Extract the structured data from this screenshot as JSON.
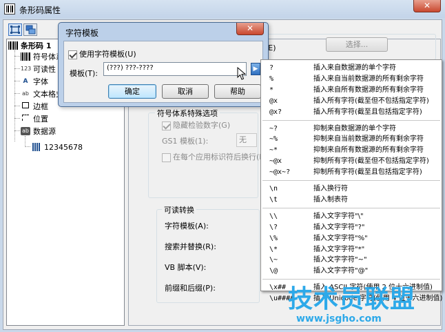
{
  "main_window": {
    "title": "条形码属性"
  },
  "tree": {
    "root": "条形码 1",
    "items": [
      "符号体系",
      "可读性",
      "字体",
      "文本格式",
      "边框",
      "位置",
      "数据源"
    ],
    "child": "12345678"
  },
  "pane": {
    "settings_label": "设置(E)",
    "select_button": "选择...",
    "group_symbology_title": "符号体系特殊选项",
    "hide_check_digit": "隐藏检验数字(G)",
    "gs1_template_label": "GS1 模板(1):",
    "gs1_template_value": "无",
    "wrap_each_ai": "在每个应用标识符后换行(L",
    "group_readable_title": "可读转换",
    "readable_rows": [
      "字符模板(A):",
      "搜索并替换(R):",
      "VB 脚本(V):",
      "前缀和后缀(P):"
    ]
  },
  "dialog": {
    "title": "字符模板",
    "close_glyph": "✕",
    "use_template_label": "使用字符模板(U)",
    "template_label": "模板(T):",
    "template_value": "(???) ???-????",
    "ok_button": "确定",
    "cancel_button": "取消",
    "help_button": "帮助"
  },
  "menu": {
    "groups": [
      [
        {
          "code": "?",
          "desc": "插入来自数据源的单个字符"
        },
        {
          "code": "%",
          "desc": "插入来自当前数据源的所有剩余字符"
        },
        {
          "code": "*",
          "desc": "插入来自所有数据源的所有剩余字符"
        },
        {
          "code": "@x",
          "desc": "插入所有字符(截至但不包括指定字符)"
        },
        {
          "code": "@x?",
          "desc": "插入所有字符(截至且包括指定字符)"
        }
      ],
      [
        {
          "code": "~?",
          "desc": "抑制来自数据源的单个字符"
        },
        {
          "code": "~%",
          "desc": "抑制来自当前数据源的所有剩余字符"
        },
        {
          "code": "~*",
          "desc": "抑制来自所有数据源的所有剩余字符"
        },
        {
          "code": "~@x",
          "desc": "抑制所有字符(截至但不包括指定字符)"
        },
        {
          "code": "~@x~?",
          "desc": "抑制所有字符(截至且包括指定字符)"
        }
      ],
      [
        {
          "code": "\\n",
          "desc": "插入换行符"
        },
        {
          "code": "\\t",
          "desc": "插入制表符"
        }
      ],
      [
        {
          "code": "\\\\",
          "desc": "插入文字字符\"\\\""
        },
        {
          "code": "\\?",
          "desc": "插入文字字符\"?\""
        },
        {
          "code": "\\%",
          "desc": "插入文字字符\"%\""
        },
        {
          "code": "\\*",
          "desc": "插入文字字符\"*\""
        },
        {
          "code": "\\~",
          "desc": "插入文字字符\"~\""
        },
        {
          "code": "\\@",
          "desc": "插入文字字符\"@\""
        }
      ],
      [
        {
          "code": "\\x##",
          "desc": "插入 ASCII 字符(使用 2 位十六进制值)"
        },
        {
          "code": "\\u####",
          "desc": "插入 Unicode 字符(使用 4 位十六进制值)"
        }
      ]
    ]
  },
  "watermark": {
    "text": "技术员联盟",
    "url": "www.jsgho.com"
  },
  "colors": {
    "accent": "#3c7fb1",
    "close": "#c9482f",
    "watermark": "#2da9e9"
  }
}
